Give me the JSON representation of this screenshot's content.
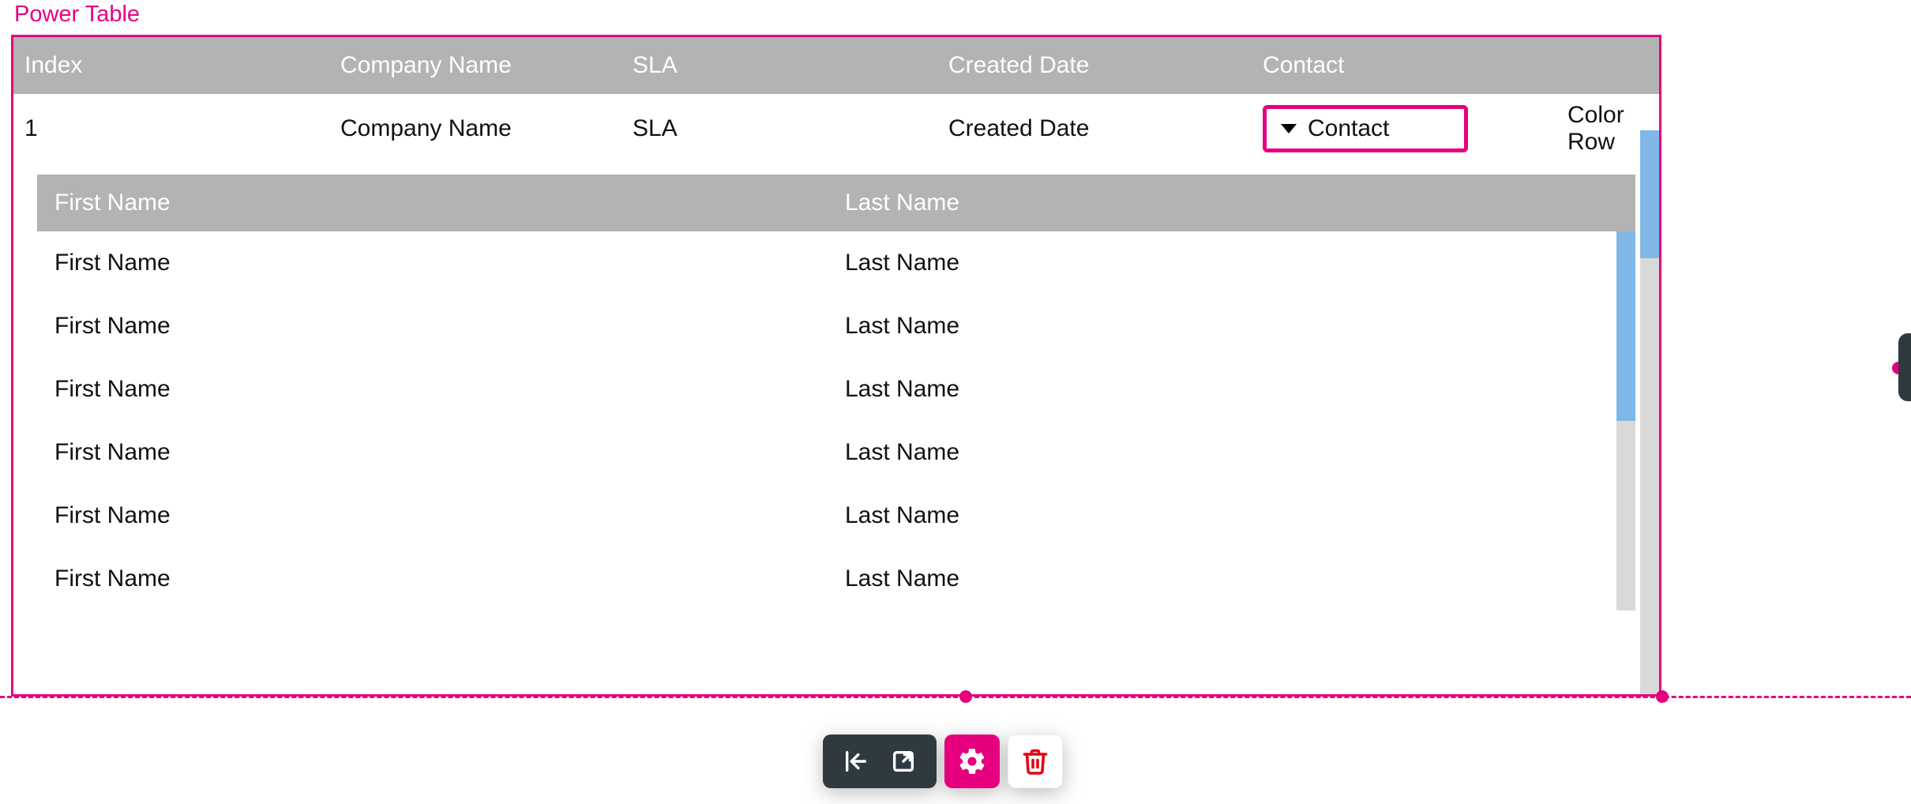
{
  "widget": {
    "label": "Power Table"
  },
  "outer": {
    "headers": {
      "index": "Index",
      "company": "Company Name",
      "sla": "SLA",
      "created": "Created Date",
      "contact": "Contact"
    },
    "row": {
      "index": "1",
      "company": "Company Name",
      "sla": "SLA",
      "created": "Created Date",
      "contact": "Contact",
      "colorrow": "Color Row"
    }
  },
  "nested": {
    "headers": {
      "first": "First Name",
      "last": "Last Name"
    },
    "rows": [
      {
        "first": "First Name",
        "last": "Last Name"
      },
      {
        "first": "First Name",
        "last": "Last Name"
      },
      {
        "first": "First Name",
        "last": "Last Name"
      },
      {
        "first": "First Name",
        "last": "Last Name"
      },
      {
        "first": "First Name",
        "last": "Last Name"
      },
      {
        "first": "First Name",
        "last": "Last Name"
      }
    ]
  },
  "icons": {
    "collapse": "collapse",
    "popout": "popout",
    "settings": "settings",
    "delete": "delete"
  }
}
